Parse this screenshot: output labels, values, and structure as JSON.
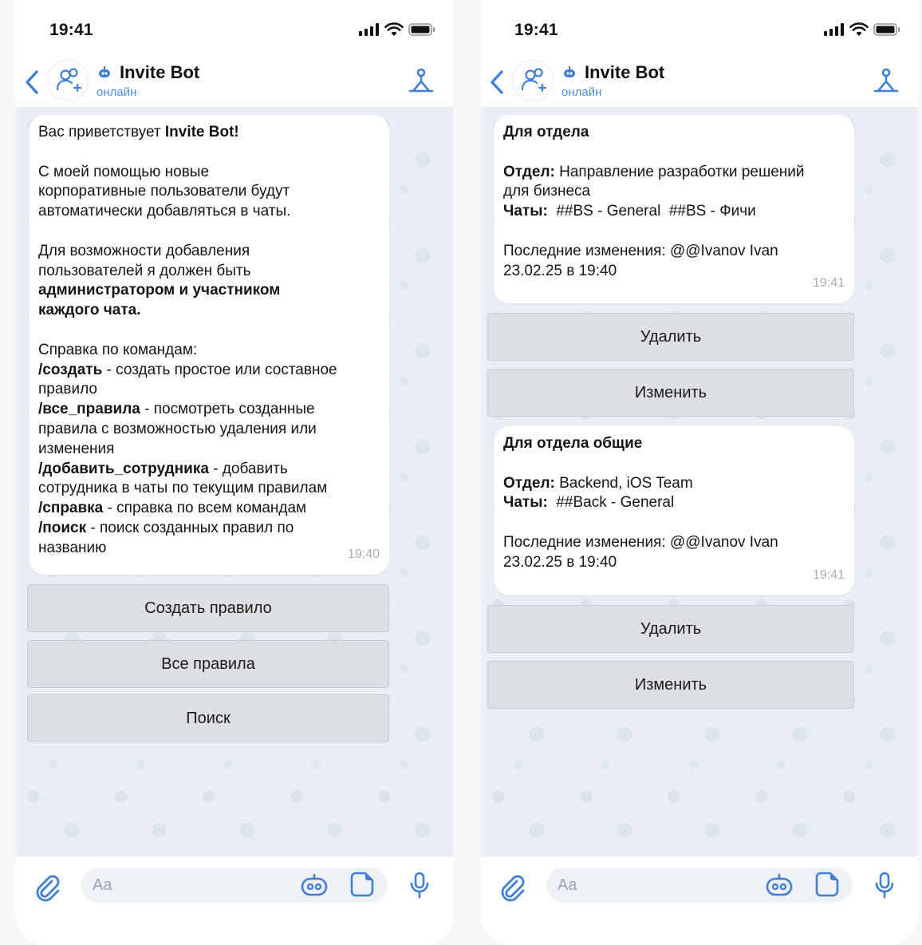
{
  "status": {
    "time": "19:41"
  },
  "header": {
    "name": "Invite Bot",
    "status": "онлайн"
  },
  "left": {
    "message": {
      "welcome_prefix": "Вас приветствует ",
      "welcome_bold": "Invite Bot!",
      "intro_lines": [
        "С моей помощью новые",
        "корпоративные пользователи будут",
        "автоматически добавляться в чаты."
      ],
      "admin_lines": [
        "Для возможности добавления",
        "пользователей я должен быть"
      ],
      "admin_bold_lines": [
        "администратором и участником",
        "каждого чата."
      ],
      "help_title": "Справка по командам:",
      "commands": [
        {
          "cmd": "/создать",
          "text": " - создать простое или составное",
          "cont": [
            "правило"
          ]
        },
        {
          "cmd": "/все_правила",
          "text": " - посмотреть созданные",
          "cont": [
            "правила с возможностью удаления или",
            "изменения"
          ]
        },
        {
          "cmd": "/добавить_сотрудника",
          "text": " - добавить",
          "cont": [
            "сотрудника в чаты по текущим правилам"
          ]
        },
        {
          "cmd": "/справка",
          "text": " - справка по всем командам",
          "cont": []
        },
        {
          "cmd": "/поиск",
          "text": " - поиск созданных правил по",
          "cont": [
            "названию"
          ]
        }
      ],
      "time": "19:40"
    },
    "buttons": [
      "Создать правило",
      "Все правила",
      "Поиск"
    ]
  },
  "right": {
    "rules": [
      {
        "title": "Для отдела",
        "dept_label": "Отдел:",
        "dept_lines": [
          " Направление разработки решений",
          "для бизнеса"
        ],
        "chats_label": "Чаты:",
        "chats": "  ##BS - General  ##BS - Фичи",
        "changes_line1": "Последние изменения: @@Ivanov Ivan",
        "changes_line2": "23.02.25 в 19:40",
        "time": "19:41"
      },
      {
        "title": "Для отдела общие",
        "dept_label": "Отдел:",
        "dept_lines": [
          " Backend, iOS Team"
        ],
        "chats_label": "Чаты:",
        "chats": "  ##Back - General",
        "changes_line1": "Последние изменения: @@Ivanov Ivan",
        "changes_line2": "23.02.25 в 19:40",
        "time": "19:41"
      }
    ],
    "buttons": {
      "delete": "Удалить",
      "edit": "Изменить"
    }
  },
  "input": {
    "placeholder": "Aa"
  },
  "colors": {
    "accent": "#3f7fd6",
    "button_bg": "#dcdfe3",
    "bubble": "#ffffff"
  }
}
